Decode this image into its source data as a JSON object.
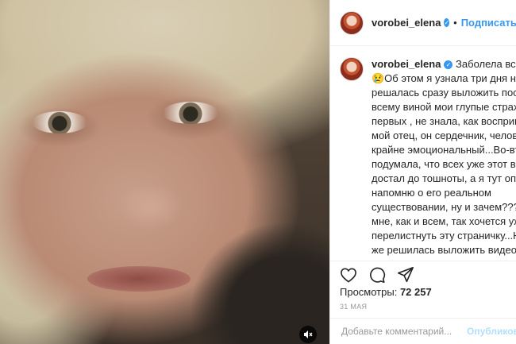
{
  "post": {
    "username": "vorobei_elena",
    "follow_label": "Подписаться",
    "dot": "•",
    "verified_mark": "✓",
    "caption_username": "vorobei_elena",
    "caption_text": " Заболела всё-таки\n😢Об этом я узнала три дня назад...н\nрешалась сразу выложить пост, а\nвсему виной мои глупые страхи.....В\nпервых , не знала, как воспримет эт\nмой отец, он сердечник, человек\nкрайне эмоциональный...Во-вторых\nподумала, что всех уже этот вирус\nдостал до тошноты, а я тут опять\nнапомню о его реальном\nсуществовании, ну и зачем???ведь\nмне, как и всем, так хочется уже\nперелистнуть эту страничку...Но я в\nже решилась выложить видео, чтоб\nподдержать тех, кто находится сейч\nв таком же состоянии как я, в\nсостоянии тревоги, когда"
  },
  "stats": {
    "views_label": "Просмотры:",
    "views_value": "72 257",
    "date": "31 МАЯ"
  },
  "comment_box": {
    "placeholder": "Добавьте комментарий...",
    "publish_label": "Опубликов"
  },
  "icons": {
    "like": "heart-icon",
    "comment": "comment-icon",
    "share": "share-icon",
    "sound": "sound-off-icon"
  },
  "colors": {
    "accent": "#3897f0",
    "publish_disabled": "#b2dffc"
  }
}
